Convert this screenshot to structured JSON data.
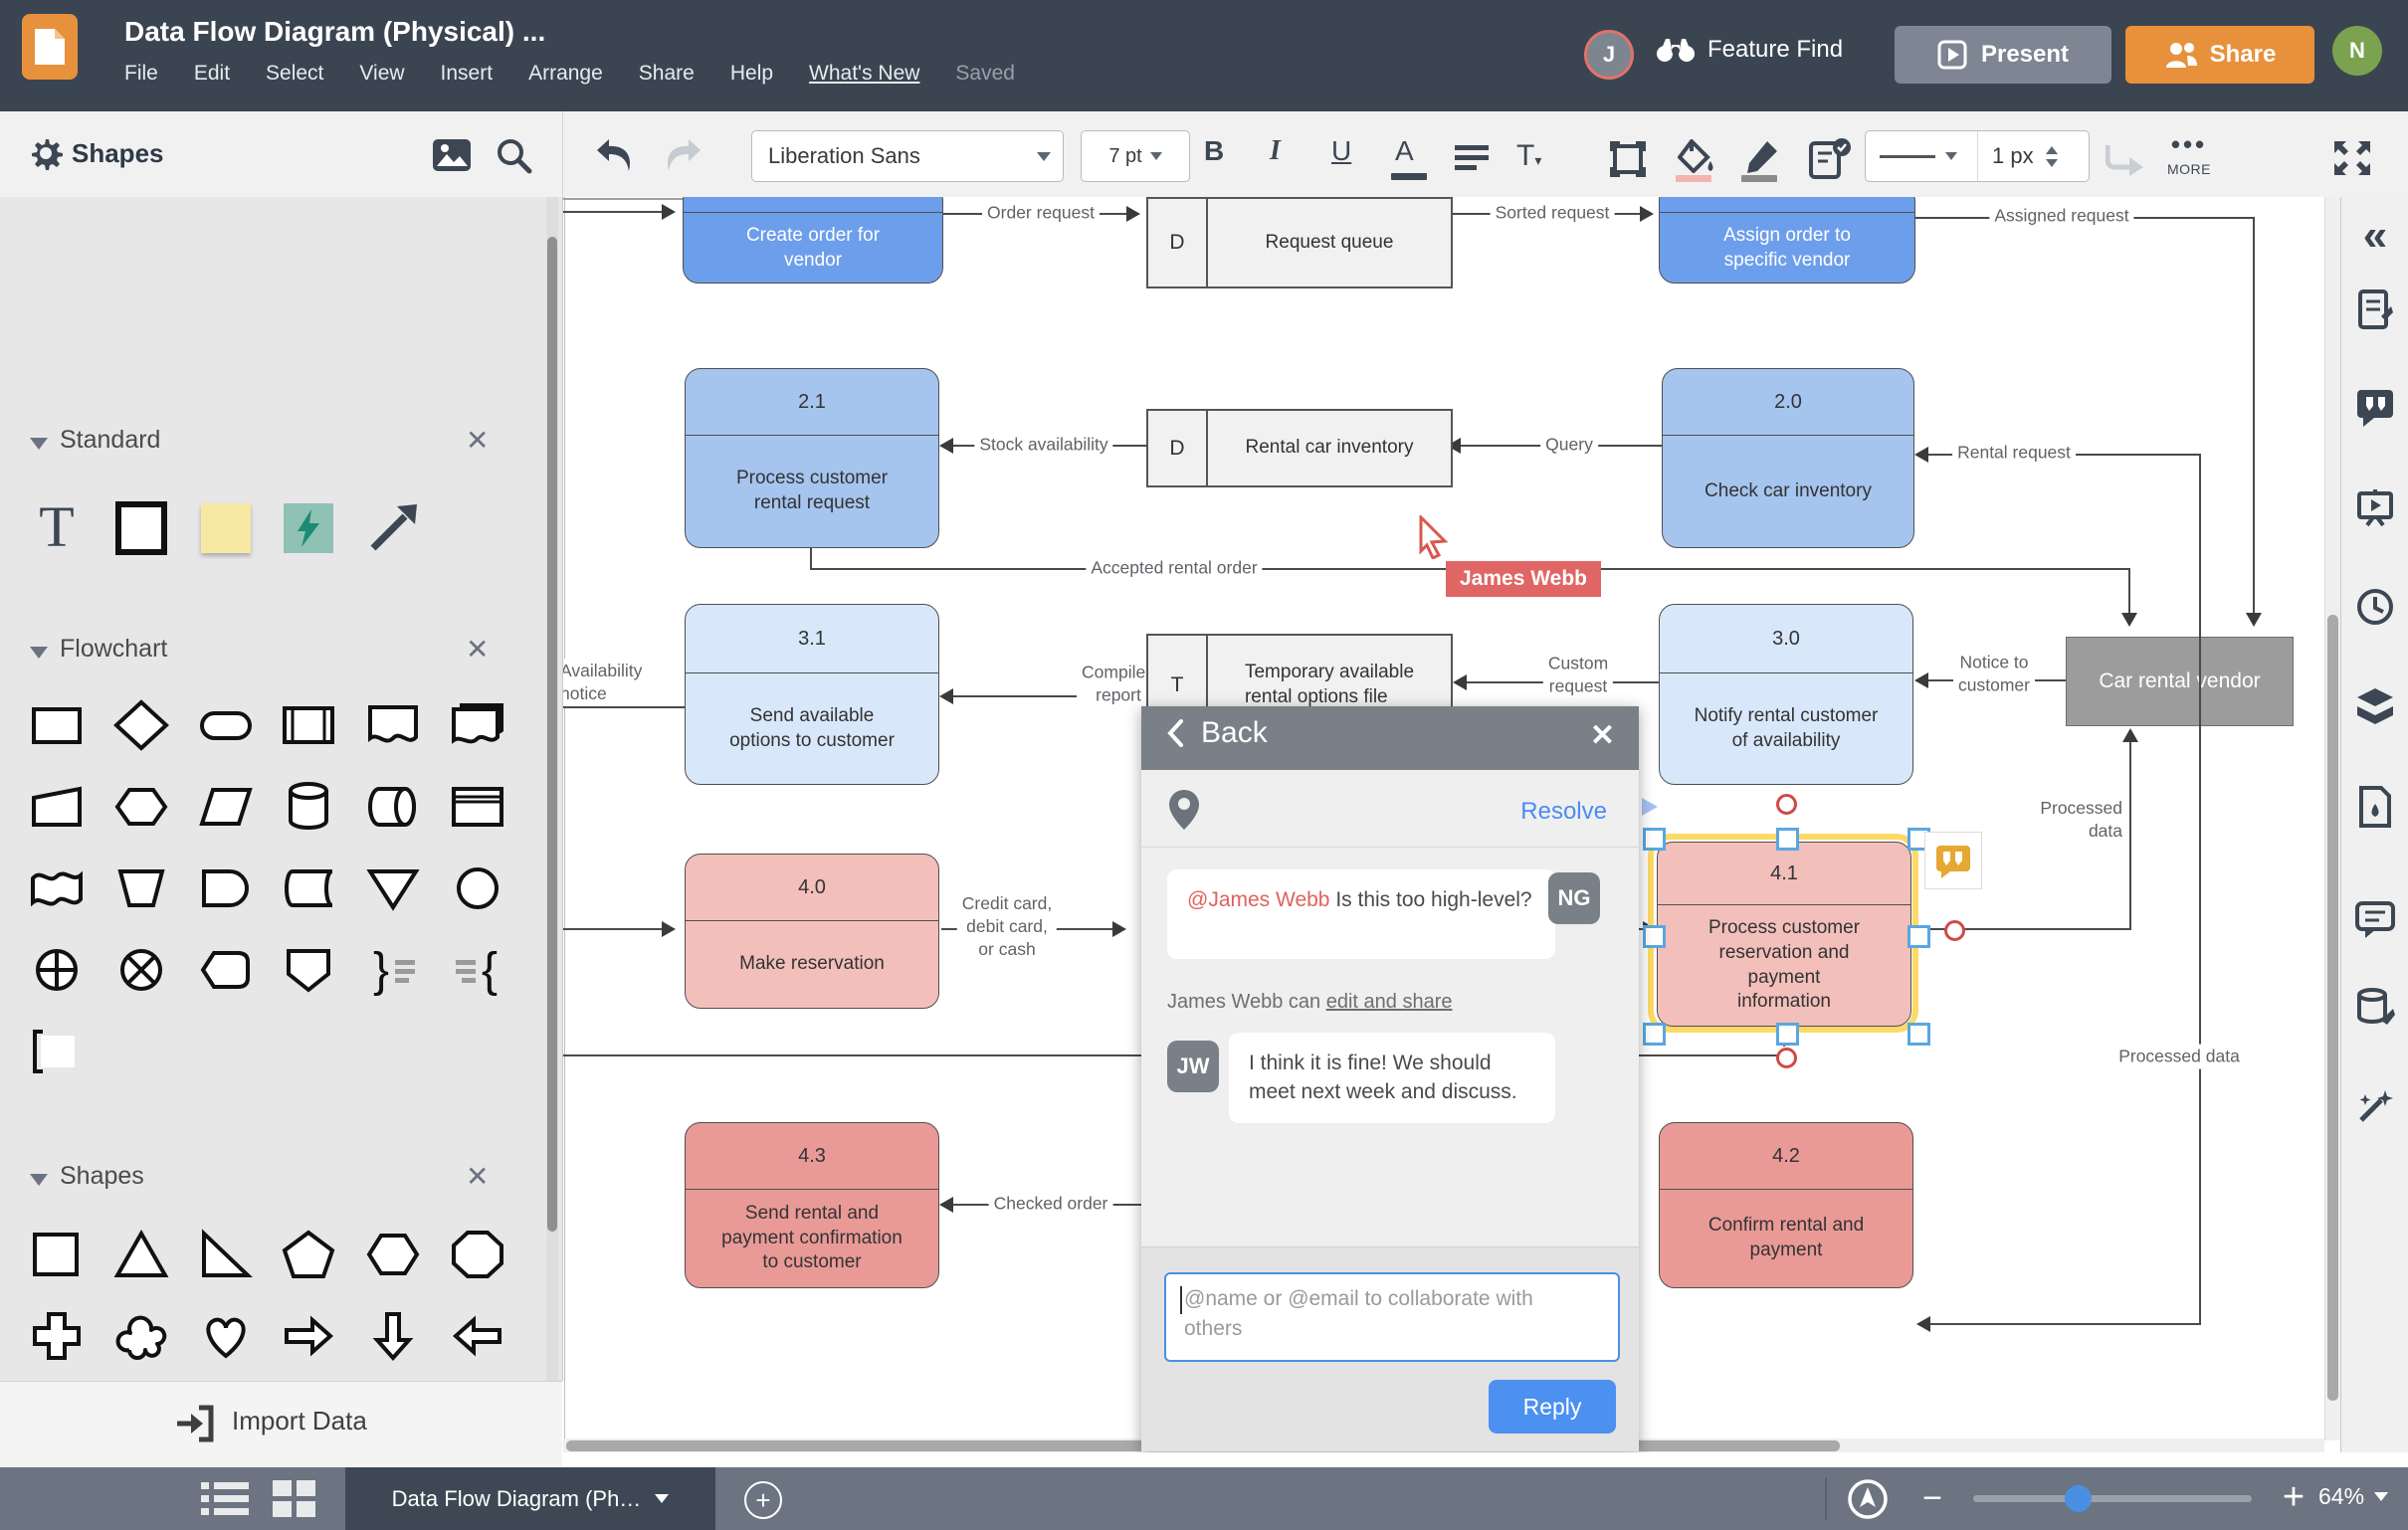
{
  "header": {
    "title": "Data Flow Diagram (Physical) ...",
    "menus": [
      "File",
      "Edit",
      "Select",
      "View",
      "Insert",
      "Arrange",
      "Share",
      "Help",
      "What's New"
    ],
    "status": "Saved",
    "feature_find": "Feature Find",
    "present": "Present",
    "share": "Share",
    "avatar_j": "J",
    "avatar_n": "N"
  },
  "toolbar": {
    "font": "Liberation Sans",
    "size": "7 pt",
    "bold": "B",
    "italic": "I",
    "underline": "U",
    "color_a": "A",
    "line_width": "1 px",
    "more": "MORE"
  },
  "sidebar": {
    "title": "Shapes",
    "sections": {
      "standard": "Standard",
      "flowchart": "Flowchart",
      "shapes": "Shapes"
    },
    "import_label": "Import Data"
  },
  "diagram": {
    "nodes": {
      "create": {
        "label": "Create order for\nvendor"
      },
      "assign": {
        "label": "Assign order to\nspecific vendor"
      },
      "n21": {
        "num": "2.1",
        "label": "Process customer\nrental request"
      },
      "n20": {
        "num": "2.0",
        "label": "Check car inventory"
      },
      "n31": {
        "num": "3.1",
        "label": "Send available\noptions to customer"
      },
      "n30": {
        "num": "3.0",
        "label": "Notify rental customer\nof availability"
      },
      "n40": {
        "num": "4.0",
        "label": "Make reservation"
      },
      "n41": {
        "num": "4.1",
        "label": "Process customer\nreservation and\npayment\ninformation"
      },
      "n43": {
        "num": "4.3",
        "label": "Send rental and\npayment confirmation\nto customer"
      },
      "n42": {
        "num": "4.2",
        "label": "Confirm rental and\npayment"
      },
      "store_queue": {
        "prefix": "D",
        "label": "Request queue"
      },
      "store_inventory": {
        "prefix": "D",
        "label": "Rental car inventory"
      },
      "store_temp": {
        "prefix": "T",
        "label": "Temporary available\nrental options file"
      },
      "vendor": {
        "label": "Car rental vendor"
      }
    },
    "edge_labels": {
      "order_request": "Order request",
      "sorted_request": "Sorted request",
      "assigned_request": "Assigned request",
      "stock_availability": "Stock availability",
      "query": "Query",
      "rental_request": "Rental request",
      "accepted_order": "Accepted rental order",
      "availability_notice": "Availability\nnotice",
      "compiled_report": "Compiled\nreport",
      "custom_request": "Custom\nrequest",
      "notice_to_customer": "Notice to\ncustomer",
      "processed_up": "Processed\ndata",
      "processed_down": "Processed data",
      "credit": "Credit card,\ndebit card,\nor cash",
      "checked_order": "Checked order"
    },
    "cursor_label": "James Webb"
  },
  "dialog": {
    "back": "Back",
    "resolve": "Resolve",
    "comment1": {
      "mention": "@James Webb",
      "text": " Is this too high-level?",
      "avatar": "NG"
    },
    "permission_prefix": "James Webb can ",
    "permission_link": "edit and share",
    "comment2": {
      "avatar": "JW",
      "text": "I think it is fine! We should meet next week and discuss."
    },
    "input_placeholder": "@name or @email to collaborate with others",
    "reply": "Reply"
  },
  "bottom": {
    "tab": "Data Flow Diagram (Ph…",
    "zoom": "64%"
  },
  "colors": {
    "header_bg": "#3b4552",
    "accent_orange": "#e8913c",
    "accent_blue": "#4a90e2",
    "process_blue": "#6d9eeb",
    "process_blue_light": "#a5c4ee",
    "process_blue_pale": "#d9e7fb",
    "process_pink": "#f2bfbb",
    "process_pink_dark": "#e99a97",
    "vendor_gray": "#9c9c9c",
    "cursor_red": "#e06666",
    "selection_yellow": "#fed966"
  }
}
